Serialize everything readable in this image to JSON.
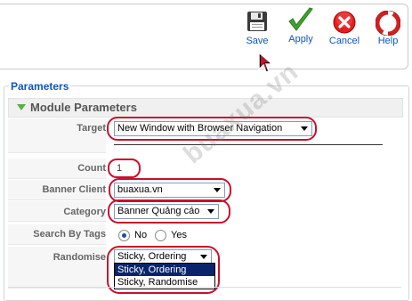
{
  "toolbar": {
    "save_label": "Save",
    "apply_label": "Apply",
    "cancel_label": "Cancel",
    "help_label": "Help"
  },
  "parameters": {
    "legend": "Parameters",
    "module_title": "Module Parameters",
    "target": {
      "label": "Target",
      "value": "New Window with Browser Navigation"
    },
    "count": {
      "label": "Count",
      "value": "1"
    },
    "banner_client": {
      "label": "Banner Client",
      "value": "buaxua.vn"
    },
    "category": {
      "label": "Category",
      "value": "Banner Quảng cáo"
    },
    "search_by_tags": {
      "label": "Search By Tags",
      "no": "No",
      "yes": "Yes",
      "selected": "No"
    },
    "randomise": {
      "label": "Randomise",
      "value": "Sticky, Ordering",
      "options": [
        "Sticky, Ordering",
        "Sticky, Randomise"
      ]
    }
  },
  "watermark": "buaxua.vn",
  "colors": {
    "accent": "#0b55c4",
    "highlight_ring": "#c8102e",
    "toggle_green": "#5cae4d"
  }
}
